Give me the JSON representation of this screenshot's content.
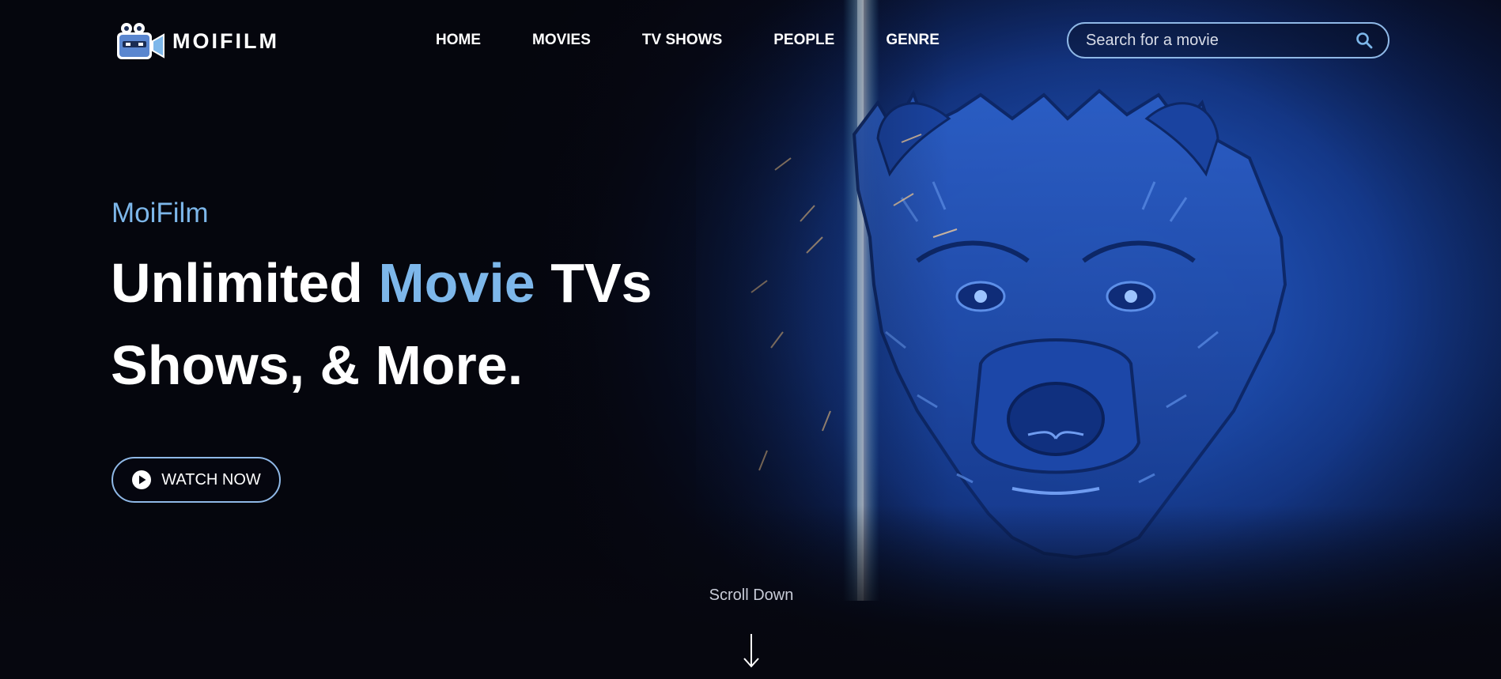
{
  "brand": {
    "name": "MOIFILM"
  },
  "nav": {
    "items": [
      {
        "label": "HOME"
      },
      {
        "label": "MOVIES"
      },
      {
        "label": "TV SHOWS"
      },
      {
        "label": "PEOPLE"
      },
      {
        "label": "GENRE"
      }
    ]
  },
  "search": {
    "placeholder": "Search for a movie",
    "icon": "search-icon"
  },
  "hero": {
    "eyebrow": "MoiFilm",
    "headline_part1": "Unlimited ",
    "headline_accent": "Movie",
    "headline_part2": " TVs Shows, & More.",
    "watch_label": "WATCH NOW",
    "watch_icon": "play-icon",
    "artwork": "blue-bear-face-artwork"
  },
  "scroll": {
    "label": "Scroll Down",
    "icon": "arrow-down-icon"
  },
  "colors": {
    "accent": "#7db7ea",
    "border": "#8fb8e6",
    "background": "#06070f",
    "hero_blue": "#1f4fb0"
  }
}
